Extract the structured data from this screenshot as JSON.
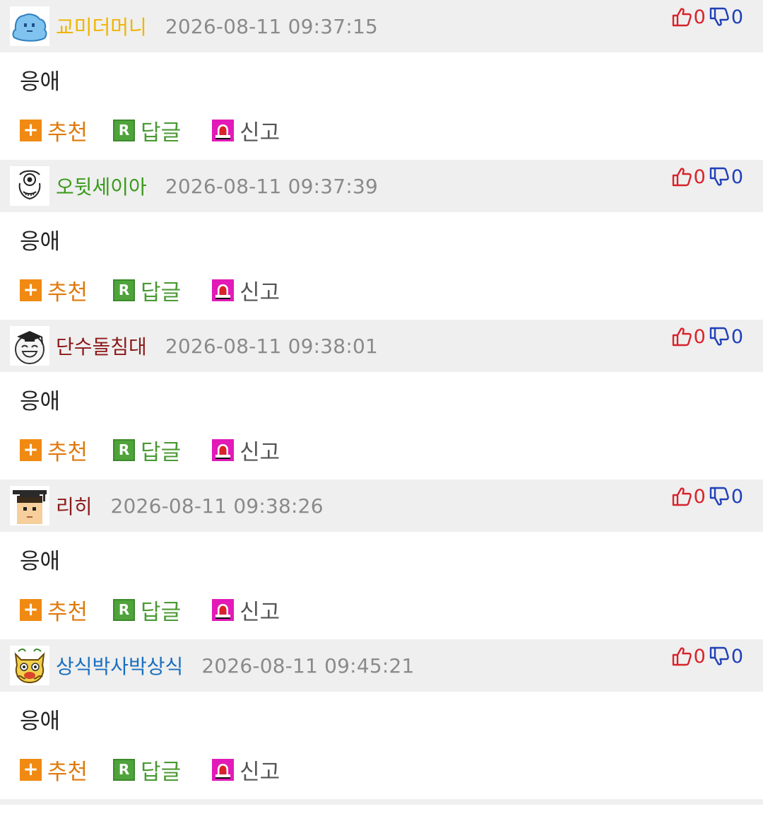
{
  "labels": {
    "recommend": "추천",
    "reply": "답글",
    "report": "신고"
  },
  "comments": [
    {
      "nickname": "교미더머니",
      "nick_color": "#f0b400",
      "avatar": "blue-slime-avatar",
      "timestamp": "2026-08-11 09:37:15",
      "upvotes": "0",
      "downvotes": "0",
      "text": "응애"
    },
    {
      "nickname": "오뒷세이아",
      "nick_color": "#3a9a1a",
      "avatar": "cyclops-face-avatar",
      "timestamp": "2026-08-11 09:37:39",
      "upvotes": "0",
      "downvotes": "0",
      "text": "응애"
    },
    {
      "nickname": "단수돌침대",
      "nick_color": "#8b1a1a",
      "avatar": "graduate-smiley-avatar",
      "timestamp": "2026-08-11 09:38:01",
      "upvotes": "0",
      "downvotes": "0",
      "text": "응애"
    },
    {
      "nickname": "리히",
      "nick_color": "#8b1a1a",
      "avatar": "graduate-boy-avatar",
      "timestamp": "2026-08-11 09:38:26",
      "upvotes": "0",
      "downvotes": "0",
      "text": "응애"
    },
    {
      "nickname": "상식박사박상식",
      "nick_color": "#1a6fbf",
      "avatar": "yellow-cat-avatar",
      "timestamp": "2026-08-11 09:45:21",
      "upvotes": "0",
      "downvotes": "0",
      "text": "응애"
    }
  ]
}
